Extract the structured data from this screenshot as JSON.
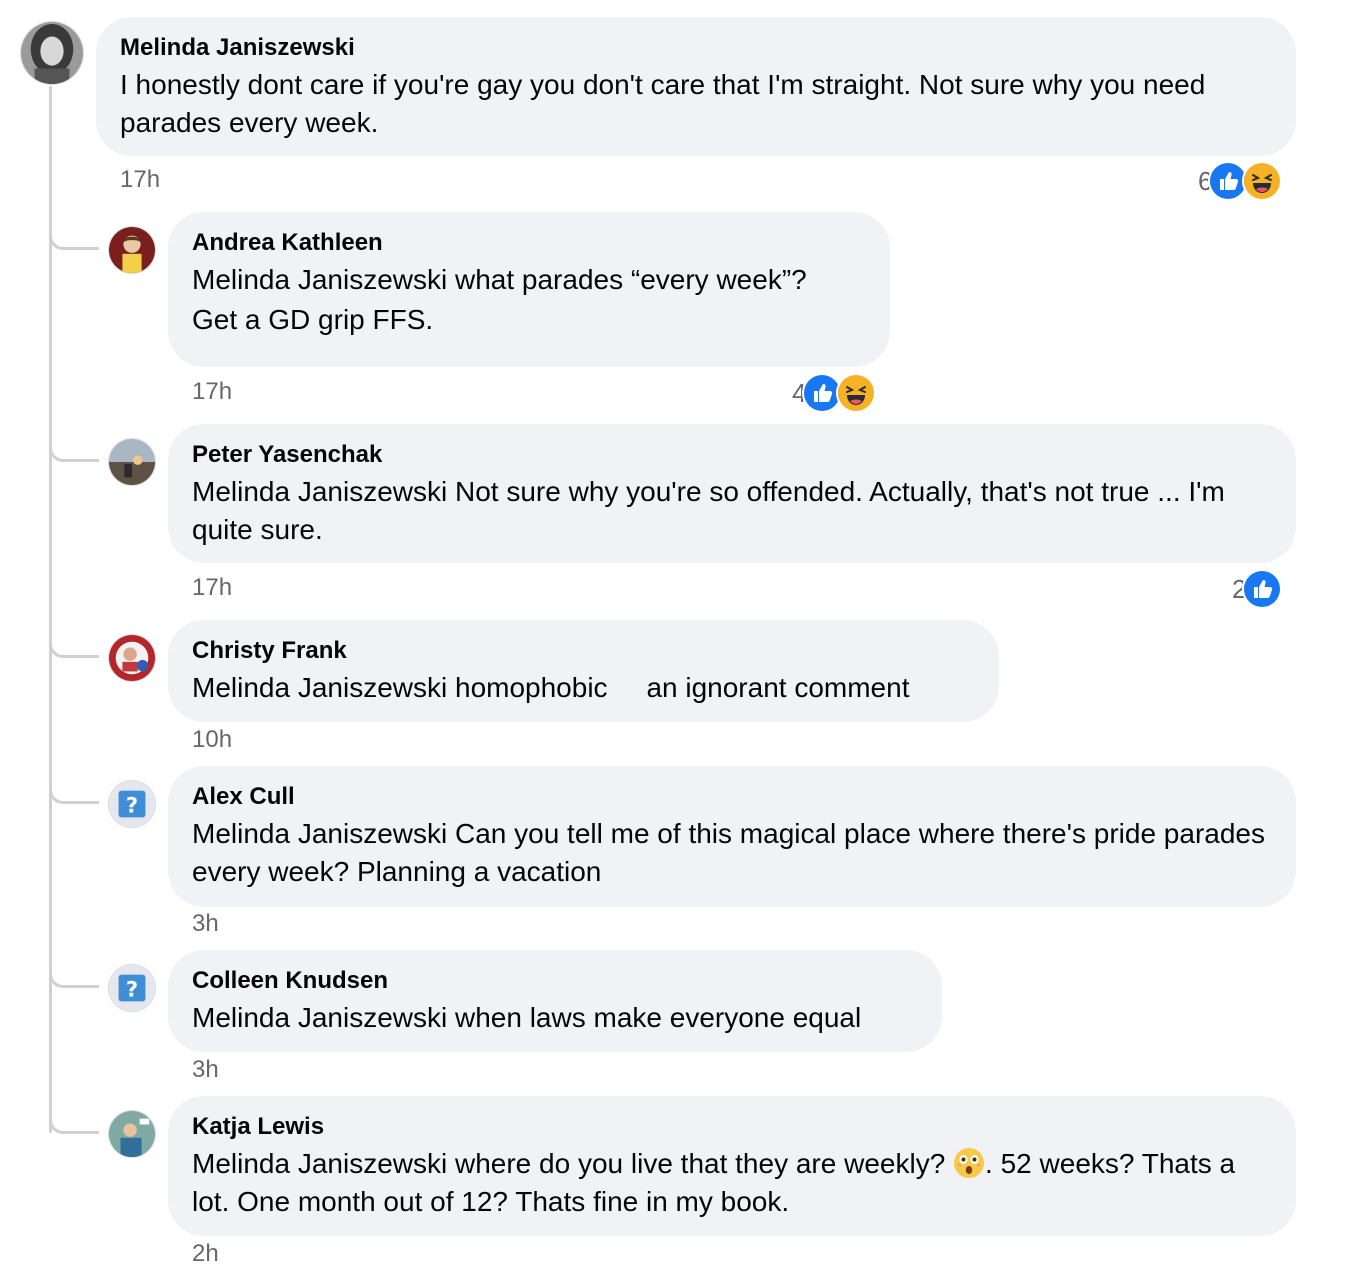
{
  "comments": [
    {
      "author": "Melinda Janiszewski",
      "text": "I honestly dont care if you're gay you don't care that I'm straight. Not sure why you need parades every week.",
      "time": "17h",
      "reaction_count": "6",
      "reactions": [
        "like",
        "haha"
      ]
    },
    {
      "author": "Andrea Kathleen",
      "text_line1": "Melinda Janiszewski what parades “every week”?",
      "text_line2": "Get a GD grip FFS.",
      "time": "17h",
      "reaction_count": "4",
      "reactions": [
        "like",
        "haha"
      ]
    },
    {
      "author": "Peter Yasenchak",
      "text": "Melinda Janiszewski Not sure why you're so offended. Actually, that's not true ... I'm quite sure.",
      "time": "17h",
      "reaction_count": "2",
      "reactions": [
        "like"
      ]
    },
    {
      "author": "Christy Frank",
      "text": "Melinda Janiszewski homophobic     an ignorant comment",
      "time": "10h"
    },
    {
      "author": "Alex Cull",
      "text": "Melinda Janiszewski Can you tell me of this magical place where there's pride parades every week? Planning a vacation",
      "time": "3h"
    },
    {
      "author": "Colleen Knudsen",
      "text": "Melinda Janiszewski when laws make everyone equal",
      "time": "3h"
    },
    {
      "author": "Katja Lewis",
      "text_before_emoji": "Melinda Janiszewski where do you live that they are weekly?",
      "text_after_emoji": ". 52 weeks? Thats a lot. One month out of 12? Thats fine in my book.",
      "inline_emoji": "astonished-face",
      "time": "2h"
    }
  ],
  "colors": {
    "bubble": "#f0f2f5",
    "meta_text": "#65676b",
    "like_blue": "#1877f2",
    "haha_yellow": "#f7b125",
    "thread_line": "#ced0d4"
  }
}
